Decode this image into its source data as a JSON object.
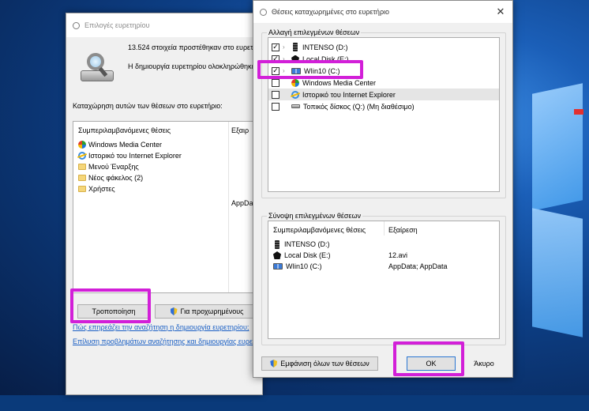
{
  "indexing_options": {
    "title": "Επιλογές ευρετηρίου",
    "status_line1": "13.524 στοιχεία προστέθηκαν στο ευρετ",
    "status_line2": "Η δημιουργία ευρετηρίου ολοκληρώθηκε",
    "index_label": "Καταχώρηση αυτών των θέσεων στο ευρετήριο:",
    "columns": [
      "Συμπεριλαμβανόμενες θέσεις",
      "Εξαιρ"
    ],
    "locations": [
      {
        "name": "Windows Media Center",
        "icon": "media-center-icon",
        "exclude": ""
      },
      {
        "name": "Ιστορικό του Internet Explorer",
        "icon": "internet-explorer-icon",
        "exclude": ""
      },
      {
        "name": "Μενού Έναρξης",
        "icon": "folder-icon",
        "exclude": ""
      },
      {
        "name": "Νέος φάκελος (2)",
        "icon": "folder-icon",
        "exclude": ""
      },
      {
        "name": "Χρήστες",
        "icon": "folder-icon",
        "exclude": "AppDa"
      }
    ],
    "modify_button": "Τροποποίηση",
    "advanced_button": "Για προχωρημένους",
    "link1": "Πώς επηρεάζει την αναζήτηση η δημιουργία ευρετηρίου;",
    "link2": "Επίλυση προβλημάτων αναζήτησης και δημιουργίας ευρετη"
  },
  "indexed_locations": {
    "title": "Θέσεις καταχωρημένες στο ευρετήριο",
    "change_group_title": "Αλλαγή επιλεγμένων θέσεων",
    "tree": [
      {
        "label": "INTENSO (D:)",
        "checked": true,
        "expandable": true,
        "icon": "usb-drive-icon",
        "selected": false
      },
      {
        "label": "Local Disk (E:)",
        "checked": true,
        "expandable": true,
        "icon": "local-disk-icon",
        "selected": false
      },
      {
        "label": "WIin10 (C:)",
        "checked": true,
        "expandable": true,
        "icon": "windows-drive-icon",
        "selected": false
      },
      {
        "label": "Windows Media Center",
        "checked": false,
        "expandable": false,
        "icon": "media-center-icon",
        "selected": false
      },
      {
        "label": "Ιστορικό του Internet Explorer",
        "checked": false,
        "expandable": false,
        "icon": "internet-explorer-icon",
        "selected": true
      },
      {
        "label": "Τοπικός δίσκος (Q:) (Μη διαθέσιμο)",
        "checked": false,
        "expandable": false,
        "icon": "hard-disk-icon",
        "selected": false
      }
    ],
    "summary_group_title": "Σύνοψη επιλεγμένων θέσεων",
    "summary_columns": [
      "Συμπεριλαμβανόμενες θέσεις",
      "Εξαίρεση"
    ],
    "summary": [
      {
        "label": "INTENSO (D:)",
        "icon": "usb-drive-icon",
        "exclude": ""
      },
      {
        "label": "Local Disk (E:)",
        "icon": "local-disk-icon",
        "exclude": "12.avi"
      },
      {
        "label": "WIin10 (C:)",
        "icon": "windows-drive-icon",
        "exclude": "AppData; AppData"
      }
    ],
    "show_all_button": "Εμφάνιση όλων των θέσεων",
    "ok_button": "ΟΚ",
    "cancel_button": "Άκυρο"
  },
  "colors": {
    "highlight": "#d21fd8",
    "link": "#1a5fc4"
  }
}
